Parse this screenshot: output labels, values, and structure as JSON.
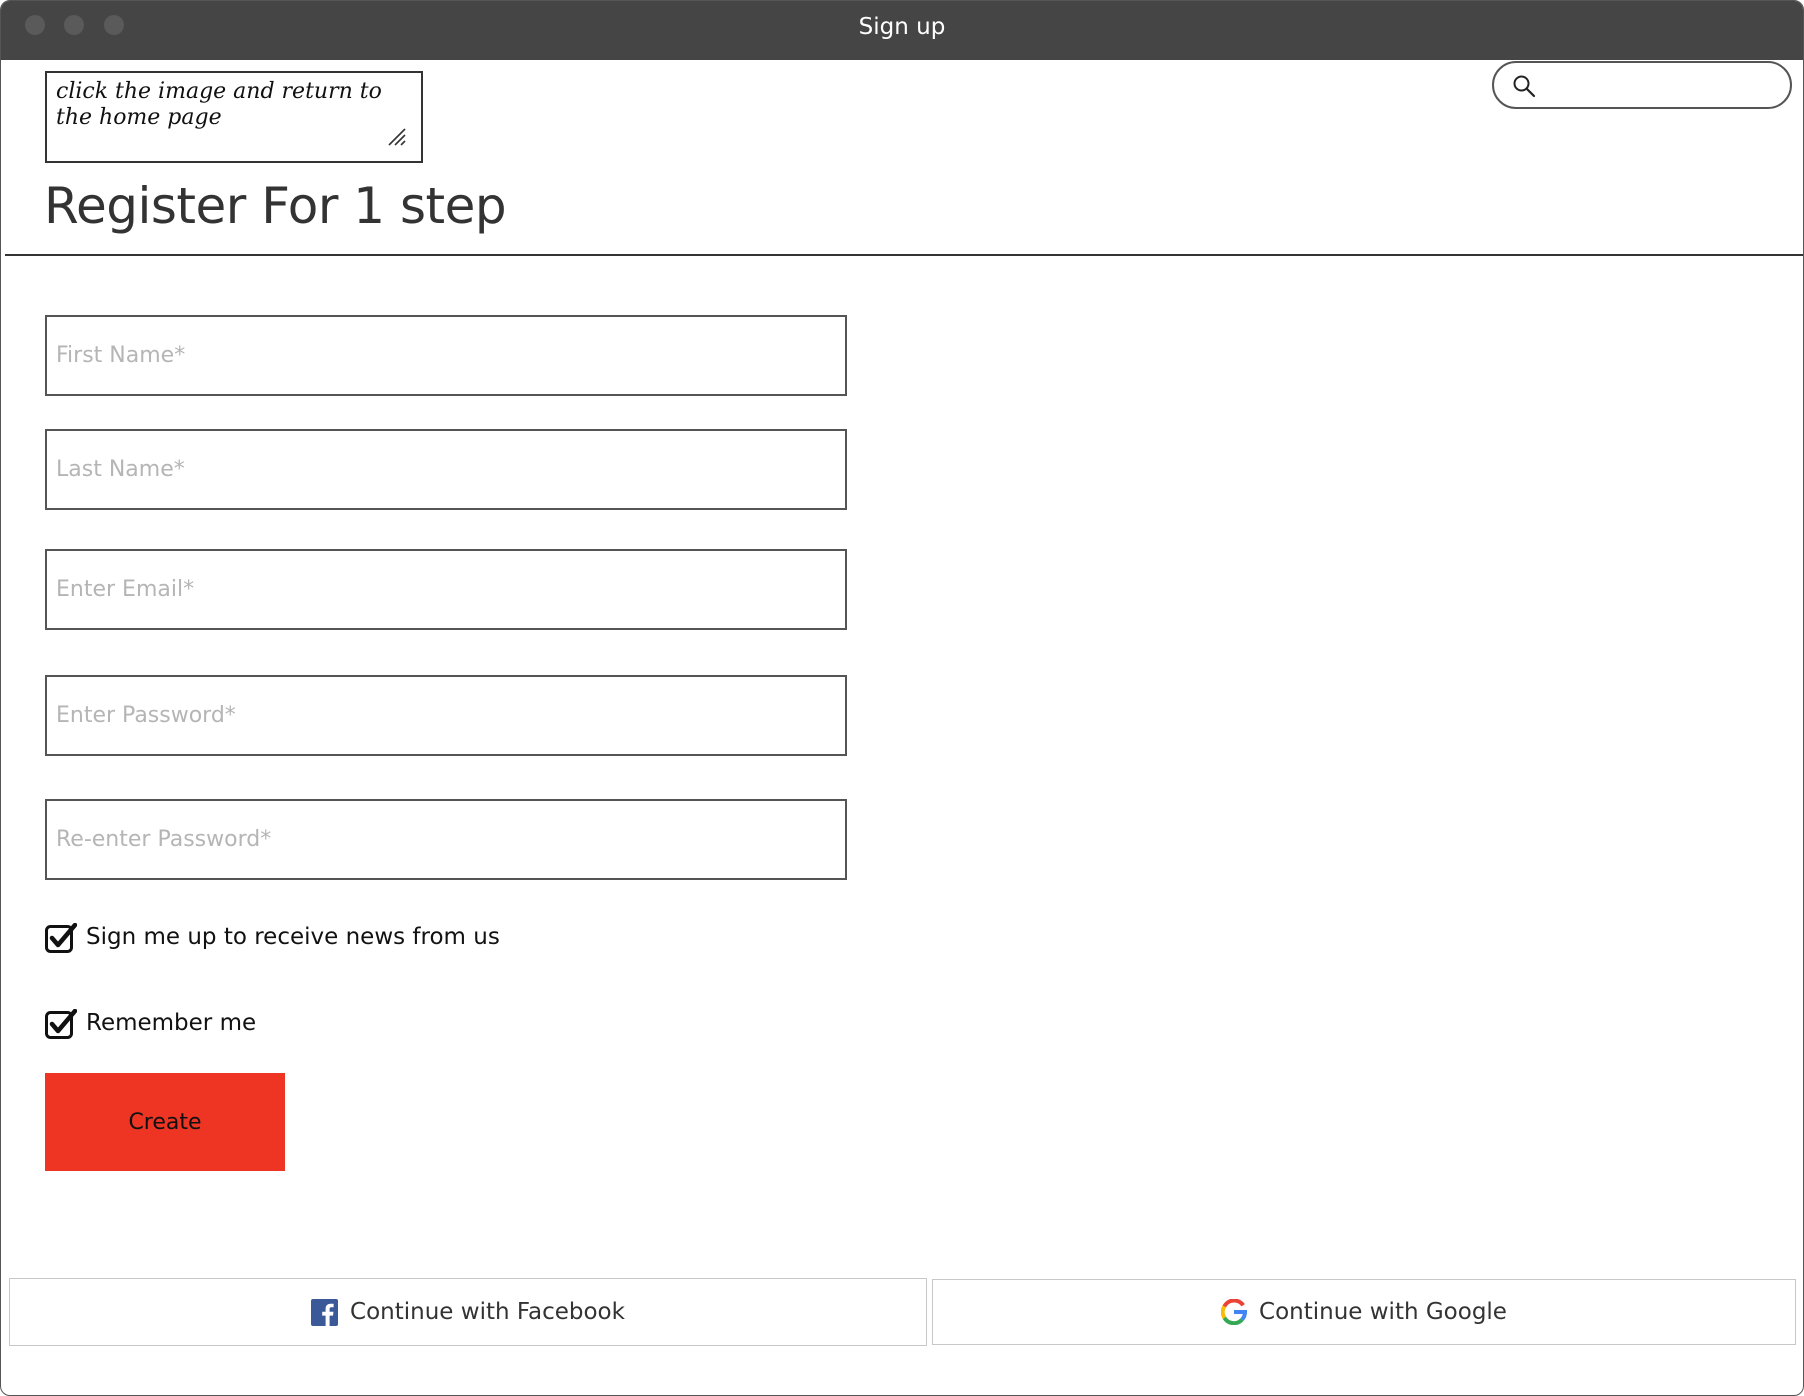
{
  "window": {
    "title": "Sign up"
  },
  "note": {
    "text": "click the image and return to the home page"
  },
  "search": {
    "value": "",
    "icon": "search-icon"
  },
  "page": {
    "heading": "Register For 1 step"
  },
  "form": {
    "first_name_placeholder": "First Name*",
    "last_name_placeholder": "Last Name*",
    "email_placeholder": "Enter Email*",
    "password_placeholder": "Enter Password*",
    "reenter_password_placeholder": "Re-enter Password*",
    "newsletter_label": "Sign me up to receive news from us",
    "newsletter_checked": true,
    "remember_label": "Remember me",
    "remember_checked": true,
    "create_label": "Create"
  },
  "social": {
    "facebook_label": "Continue with Facebook",
    "google_label": "Continue with Google"
  },
  "colors": {
    "titlebar": "#454545",
    "create_button": "#ee3524",
    "facebook_blue": "#3b5998"
  }
}
